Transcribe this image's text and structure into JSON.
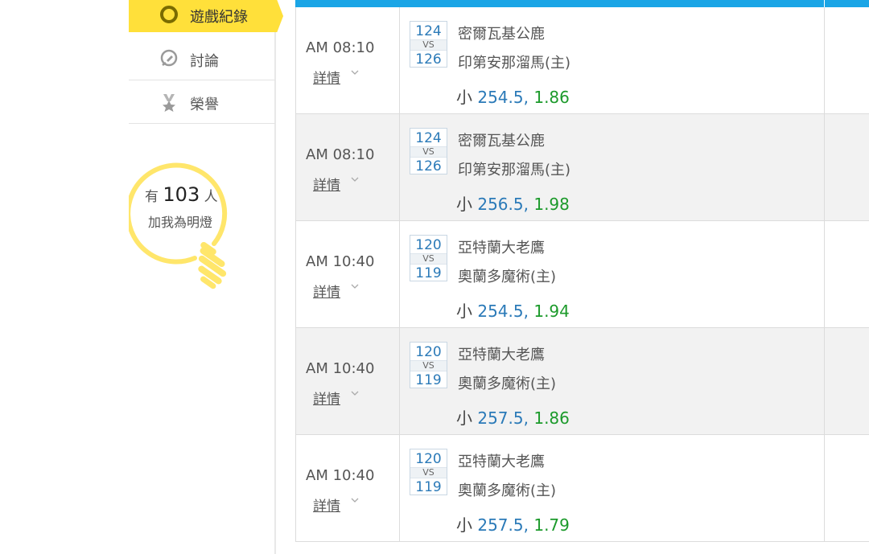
{
  "sidebar": {
    "active_tab": {
      "label": "遊戲紀錄",
      "icon": "ring-icon"
    },
    "items": [
      {
        "label": "討論",
        "icon": "discussion-icon"
      },
      {
        "label": "榮譽",
        "icon": "medal-icon"
      }
    ],
    "bulb": {
      "prefix": "有",
      "count": "103",
      "suffix": "人",
      "caption": "加我為明燈"
    }
  },
  "colors": {
    "accent": "#1aa5e6",
    "highlight": "#ffe03a",
    "score": "#2b7ab8",
    "odds": "#1c9a2b"
  },
  "games": [
    {
      "time": "AM 08:10",
      "detail": "詳情",
      "away_score": "124",
      "vs": "VS",
      "home_score": "126",
      "away_team": "密爾瓦基公鹿",
      "home_team": "印第安那溜馬(主)",
      "bet_label": "小",
      "line": "254.5,",
      "odds": "1.86"
    },
    {
      "time": "AM 08:10",
      "detail": "詳情",
      "away_score": "124",
      "vs": "VS",
      "home_score": "126",
      "away_team": "密爾瓦基公鹿",
      "home_team": "印第安那溜馬(主)",
      "bet_label": "小",
      "line": "256.5,",
      "odds": "1.98"
    },
    {
      "time": "AM 10:40",
      "detail": "詳情",
      "away_score": "120",
      "vs": "VS",
      "home_score": "119",
      "away_team": "亞特蘭大老鷹",
      "home_team": "奧蘭多魔術(主)",
      "bet_label": "小",
      "line": "254.5,",
      "odds": "1.94"
    },
    {
      "time": "AM 10:40",
      "detail": "詳情",
      "away_score": "120",
      "vs": "VS",
      "home_score": "119",
      "away_team": "亞特蘭大老鷹",
      "home_team": "奧蘭多魔術(主)",
      "bet_label": "小",
      "line": "257.5,",
      "odds": "1.86"
    },
    {
      "time": "AM 10:40",
      "detail": "詳情",
      "away_score": "120",
      "vs": "VS",
      "home_score": "119",
      "away_team": "亞特蘭大老鷹",
      "home_team": "奧蘭多魔術(主)",
      "bet_label": "小",
      "line": "257.5,",
      "odds": "1.79"
    }
  ]
}
